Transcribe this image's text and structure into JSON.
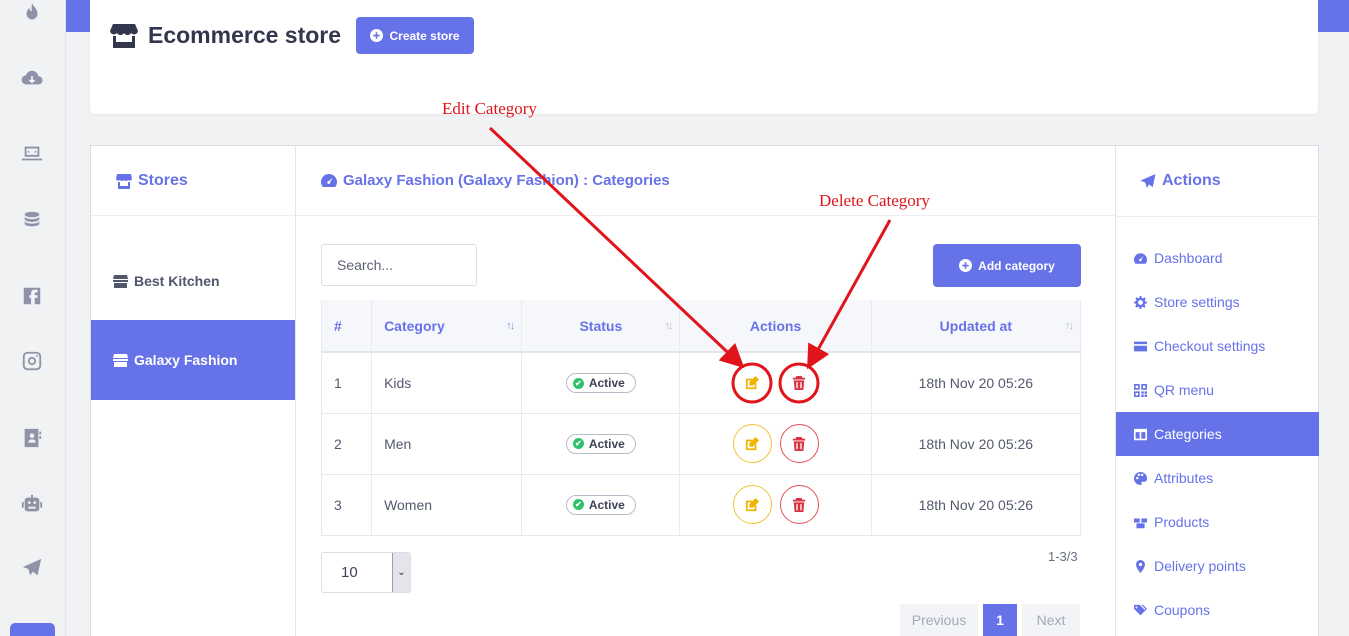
{
  "header": {
    "title": "Ecommerce store",
    "create_store_label": "Create store"
  },
  "rail": {
    "icons": [
      "fire-icon",
      "cloud-download-icon",
      "laptop-code-icon",
      "coins-icon",
      "facebook-icon",
      "instagram-icon",
      "address-book-icon",
      "robot-icon",
      "paper-plane-icon"
    ]
  },
  "stores": {
    "heading": "Stores",
    "items": [
      {
        "label": "Best Kitchen",
        "active": false
      },
      {
        "label": "Galaxy Fashion",
        "active": true
      }
    ]
  },
  "categories": {
    "heading": "Galaxy Fashion (Galaxy Fashion) : Categories",
    "search_placeholder": "Search...",
    "add_label": "Add category",
    "columns": [
      "#",
      "Category",
      "Status",
      "Actions",
      "Updated at"
    ],
    "rows": [
      {
        "num": "1",
        "category": "Kids",
        "status": "Active",
        "updated": "18th Nov 20 05:26"
      },
      {
        "num": "2",
        "category": "Men",
        "status": "Active",
        "updated": "18th Nov 20 05:26"
      },
      {
        "num": "3",
        "category": "Women",
        "status": "Active",
        "updated": "18th Nov 20 05:26"
      }
    ],
    "page_size": "10",
    "count_text": "1-3/3",
    "pager": {
      "previous": "Previous",
      "current": "1",
      "next": "Next"
    }
  },
  "actions": {
    "heading": "Actions",
    "items": [
      {
        "label": "Dashboard",
        "icon": "tachometer-icon"
      },
      {
        "label": "Store settings",
        "icon": "cog-icon"
      },
      {
        "label": "Checkout settings",
        "icon": "credit-card-icon"
      },
      {
        "label": "QR menu",
        "icon": "qrcode-icon"
      },
      {
        "label": "Categories",
        "icon": "columns-icon",
        "active": true
      },
      {
        "label": "Attributes",
        "icon": "palette-icon"
      },
      {
        "label": "Products",
        "icon": "boxes-icon"
      },
      {
        "label": "Delivery points",
        "icon": "map-marker-icon"
      },
      {
        "label": "Coupons",
        "icon": "tags-icon"
      }
    ]
  },
  "annotations": {
    "edit_label": "Edit Category",
    "delete_label": "Delete Category",
    "color": "#e0141a"
  },
  "colors": {
    "accent": "#6672e8",
    "edit": "#f0b400",
    "delete": "#d93345",
    "active_dot": "#2fc26b"
  }
}
